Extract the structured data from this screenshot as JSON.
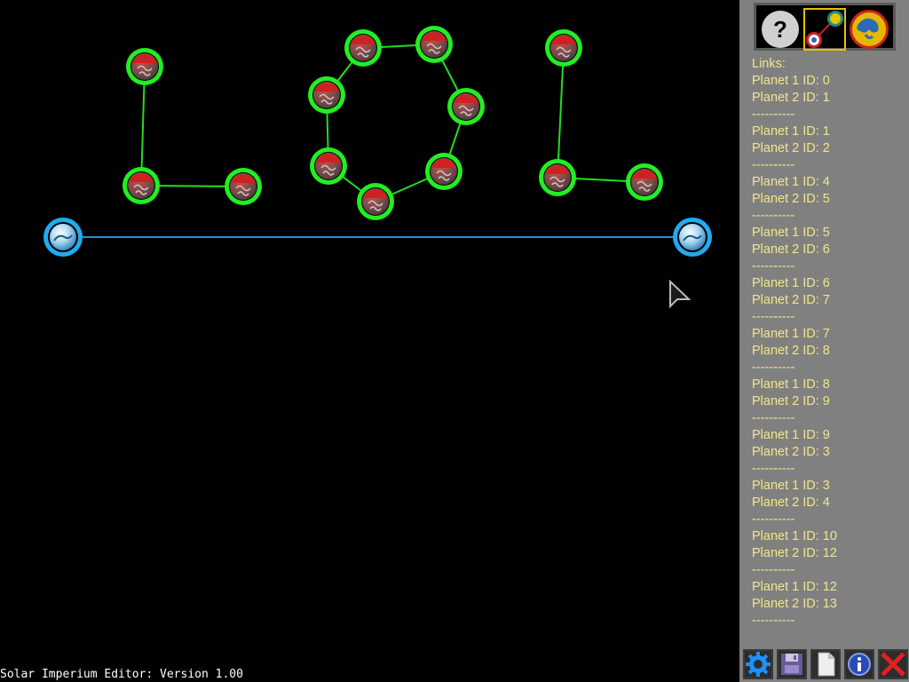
{
  "status_text": "Solar Imperium Editor: Version 1.00",
  "toolbar": {
    "help_label": "?",
    "tools": [
      "help-icon",
      "link-tool-icon",
      "planet-tool-icon"
    ]
  },
  "links": {
    "header": "Links:",
    "separator": "----------",
    "entries": [
      {
        "p1": "Planet 1 ID: 0",
        "p2": "Planet 2 ID: 1"
      },
      {
        "p1": "Planet 1 ID: 1",
        "p2": "Planet 2 ID: 2"
      },
      {
        "p1": "Planet 1 ID: 4",
        "p2": "Planet 2 ID: 5"
      },
      {
        "p1": "Planet 1 ID: 5",
        "p2": "Planet 2 ID: 6"
      },
      {
        "p1": "Planet 1 ID: 6",
        "p2": "Planet 2 ID: 7"
      },
      {
        "p1": "Planet 1 ID: 7",
        "p2": "Planet 2 ID: 8"
      },
      {
        "p1": "Planet 1 ID: 8",
        "p2": "Planet 2 ID: 9"
      },
      {
        "p1": "Planet 1 ID: 9",
        "p2": "Planet 2 ID: 3"
      },
      {
        "p1": "Planet 1 ID: 3",
        "p2": "Planet 2 ID: 4"
      },
      {
        "p1": "Planet 1 ID: 10",
        "p2": "Planet 2 ID: 12"
      },
      {
        "p1": "Planet 1 ID: 12",
        "p2": "Planet 2 ID: 13"
      }
    ]
  },
  "bottom_buttons": [
    "settings-icon",
    "save-icon",
    "new-file-icon",
    "info-icon",
    "close-icon"
  ],
  "colors": {
    "link_green": "#22dd22",
    "link_blue": "#2a8fd6",
    "planet_ring_green": "#22ee22",
    "planet_ring_blue": "#22aaee",
    "text_gold": "#f0e68c"
  }
}
